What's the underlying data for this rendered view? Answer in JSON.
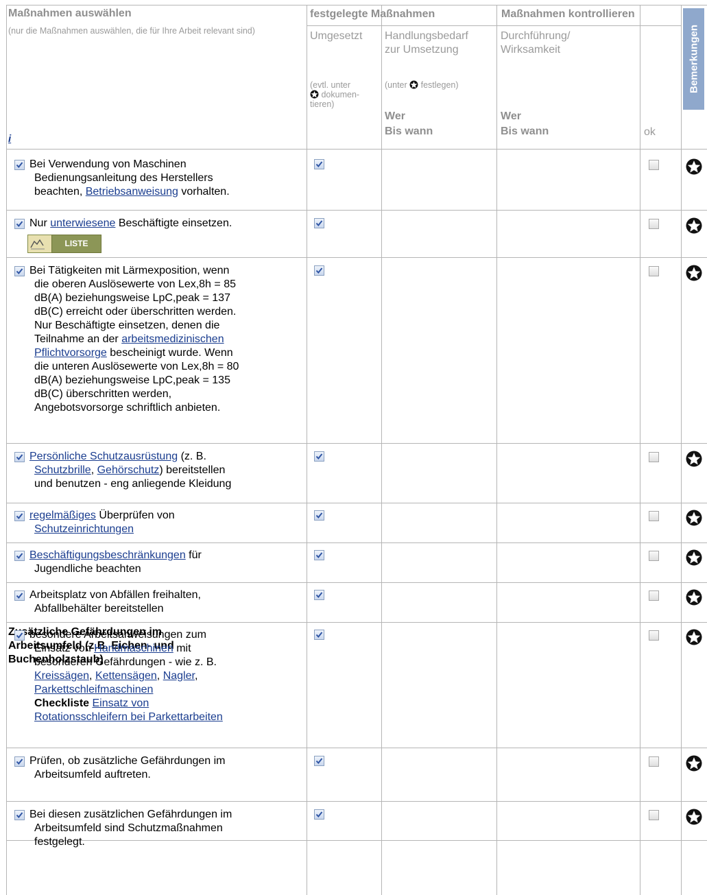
{
  "header": {
    "col1_title": "Maßnahmen auswählen",
    "col1_sub": "(nur die Maßnahmen auswählen, die für Ihre Arbeit relevant sind)",
    "col1_info": "i",
    "group_festgelegt": "festgelegte Maßnahmen",
    "group_kontrollieren": "Maßnahmen kontrollieren",
    "umgesetzt": "Umgesetzt",
    "umgesetzt_note_a": "(evtl. unter",
    "umgesetzt_note_b": "dokumen-",
    "umgesetzt_note_c": "tieren)",
    "handlungsbedarf_a": "Handlungsbedarf",
    "handlungsbedarf_b": "zur Umsetzung",
    "handlungsbedarf_note_a": "(unter",
    "handlungsbedarf_note_b": "festlegen)",
    "wer": "Wer",
    "bis_wann": "Bis wann",
    "durchfuehrung_a": "Durchführung/",
    "durchfuehrung_b": "Wirksamkeit",
    "wer2": "Wer",
    "bis_wann2": "Bis wann",
    "ok": "ok",
    "bemerkungen": "Bemerkungen"
  },
  "liste_button": {
    "label": "LISTE",
    "icon": "chart-icon"
  },
  "rows": [
    {
      "parts": [
        "Bei Verwendung von Maschinen",
        "Bedienungsanleitung des Herstellers",
        "beachten, ",
        "Betriebsanweisung",
        " vorhalten."
      ],
      "checked": true,
      "umgesetzt": true,
      "ok": false
    },
    {
      "parts": [
        "Nur ",
        "unterwiesene",
        " Beschäftigte einsetzen."
      ],
      "checked": true,
      "umgesetzt": true,
      "ok": false
    },
    {
      "parts": [
        "Bei Tätigkeiten mit Lärmexposition, wenn",
        "die oberen Auslösewerte von Lex,8h = 85",
        "dB(A) beziehungsweise LpC,peak = 137",
        "dB(C) erreicht oder überschritten werden.",
        "Nur Beschäftigte einsetzen, denen die",
        "Teilnahme an der ",
        "arbeitsmedizinischen",
        "Pflichtvorsorge",
        " bescheinigt wurde. Wenn",
        "die unteren Auslösewerte von Lex,8h = 80",
        "dB(A) beziehungsweise LpC,peak = 135",
        "dB(C) überschritten werden,",
        "Angebotsvorsorge schriftlich anbieten."
      ],
      "checked": true,
      "umgesetzt": true,
      "ok": false
    },
    {
      "parts": [
        "Persönliche Schutzausrüstung",
        " (z. B.",
        "Schutzbrille",
        ", ",
        "Gehörschutz",
        ") bereitstellen",
        "und benutzen - eng anliegende Kleidung"
      ],
      "checked": true,
      "umgesetzt": true,
      "ok": false
    },
    {
      "parts": [
        "regelmäßiges",
        " Überprüfen von",
        "Schutzeinrichtungen"
      ],
      "checked": true,
      "umgesetzt": true,
      "ok": false
    },
    {
      "parts": [
        "Beschäftigungsbeschränkungen",
        " für",
        "Jugendliche beachten"
      ],
      "checked": true,
      "umgesetzt": true,
      "ok": false
    },
    {
      "parts": [
        "Arbeitsplatz von Abfällen freihalten,",
        "Abfallbehälter bereitstellen"
      ],
      "checked": true,
      "umgesetzt": true,
      "ok": false
    },
    {
      "parts": [
        "besondere Arbeitsanweisungen zum",
        "Einsatz von ",
        "Handmaschinen",
        " mit",
        "besonderen Gefährdungen - wie z. B.",
        "Kreissägen",
        ", ",
        "Kettensägen",
        ", ",
        "Nagler",
        ",",
        "Parkettschleifmaschinen",
        "Checkliste",
        " ",
        "Einsatz von",
        "Rotationsschleifern bei Parkettarbeiten"
      ],
      "checked": true,
      "umgesetzt": true,
      "ok": false
    },
    {
      "parts": [
        "Prüfen, ob zusätzliche Gefährdungen im",
        "Arbeitsumfeld auftreten."
      ],
      "checked": true,
      "umgesetzt": true,
      "ok": false
    },
    {
      "parts": [
        "Bei diesen zusätzlichen Gefährdungen im",
        "Arbeitsumfeld sind Schutzmaßnahmen",
        "festgelegt."
      ],
      "checked": true,
      "umgesetzt": true,
      "ok": false
    }
  ],
  "section_title": "Zusätzliche Gefährdungen im Arbeitsumfeld (z.B. Eichen- und Buchenholzstaub)",
  "section_lines": [
    "Zusätzliche Gefährdungen im",
    "Arbeitsumfeld (z.B. Eichen- und",
    "Buchenholzstaub)"
  ],
  "icons": {
    "comment": "star-circle-icon",
    "checkbox": "checkbox"
  }
}
